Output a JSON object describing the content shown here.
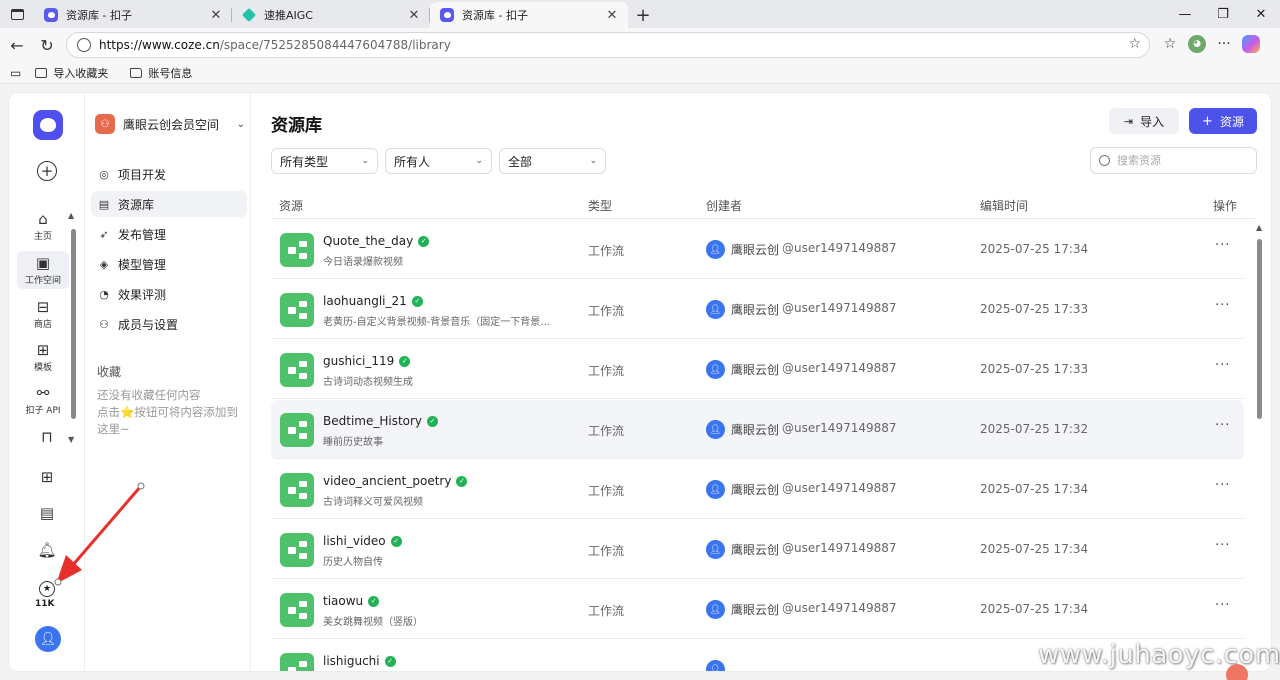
{
  "browser": {
    "tabs": [
      {
        "title": "资源库 - 扣子",
        "favicon": "coze",
        "state": "inactive"
      },
      {
        "title": "速推AIGC",
        "favicon": "aigc",
        "state": "inactive"
      },
      {
        "title": "资源库 - 扣子",
        "favicon": "coze",
        "state": "active"
      }
    ],
    "url_host": "https://www.coze.cn",
    "url_path": "/space/7525285084447604788/library",
    "bookmarks": [
      "导入收藏夹",
      "账号信息"
    ]
  },
  "rail": {
    "items": [
      {
        "label": "主页",
        "icon": "home-icon",
        "glyph": "⌂",
        "active": false
      },
      {
        "label": "工作空间",
        "icon": "terminal-icon",
        "glyph": "▣",
        "active": true
      },
      {
        "label": "商店",
        "icon": "store-icon",
        "glyph": "⊟",
        "active": false
      },
      {
        "label": "模板",
        "icon": "template-icon",
        "glyph": "⊞",
        "active": false
      },
      {
        "label": "扣子 API",
        "icon": "api-link-icon",
        "glyph": "⚯",
        "active": false
      }
    ],
    "credit_label": "11K"
  },
  "sidebar": {
    "space_name": "鹰眼云创会员空间",
    "menu": [
      {
        "label": "项目开发",
        "glyph": "◎",
        "active": false
      },
      {
        "label": "资源库",
        "glyph": "▤",
        "active": true
      },
      {
        "label": "发布管理",
        "glyph": "➶",
        "active": false
      },
      {
        "label": "模型管理",
        "glyph": "◈",
        "active": false
      },
      {
        "label": "效果评测",
        "glyph": "◔",
        "active": false
      },
      {
        "label": "成员与设置",
        "glyph": "⚇",
        "active": false
      }
    ],
    "favorites_title": "收藏",
    "favorites_empty": "还没有收藏任何内容\n点击⭐按钮可将内容添加到这里~"
  },
  "main": {
    "title": "资源库",
    "import_label": "导入",
    "add_label": "资源",
    "filters": [
      "所有类型",
      "所有人",
      "全部"
    ],
    "search_placeholder": "搜索资源",
    "columns": [
      "资源",
      "类型",
      "创建者",
      "编辑时间",
      "操作"
    ]
  },
  "rows": [
    {
      "name": "Quote_the_day",
      "desc": "今日语录爆款视频",
      "type": "工作流",
      "creator": "鹰眼云创",
      "uid": "@user1497149887",
      "time": "2025-07-25 17:34"
    },
    {
      "name": "laohuangli_21",
      "desc": "老黄历-自定义背景视频-背景音乐（固定一下背景…",
      "type": "工作流",
      "creator": "鹰眼云创",
      "uid": "@user1497149887",
      "time": "2025-07-25 17:33"
    },
    {
      "name": "gushici_119",
      "desc": "古诗词动态视频生成",
      "type": "工作流",
      "creator": "鹰眼云创",
      "uid": "@user1497149887",
      "time": "2025-07-25 17:33"
    },
    {
      "name": "Bedtime_History",
      "desc": "睡前历史故事",
      "type": "工作流",
      "creator": "鹰眼云创",
      "uid": "@user1497149887",
      "time": "2025-07-25 17:32"
    },
    {
      "name": "video_ancient_poetry",
      "desc": "古诗词释义可爱风视频",
      "type": "工作流",
      "creator": "鹰眼云创",
      "uid": "@user1497149887",
      "time": "2025-07-25 17:34"
    },
    {
      "name": "lishi_video",
      "desc": "历史人物自传",
      "type": "工作流",
      "creator": "鹰眼云创",
      "uid": "@user1497149887",
      "time": "2025-07-25 17:34"
    },
    {
      "name": "tiaowu",
      "desc": "美女跳舞视频（竖版）",
      "type": "工作流",
      "creator": "鹰眼云创",
      "uid": "@user1497149887",
      "time": "2025-07-25 17:34"
    },
    {
      "name": "lishiguchi",
      "desc": "",
      "type": "",
      "creator": "",
      "uid": "",
      "time": ""
    }
  ],
  "hover_row_index": 3,
  "watermark": "www.juhaoyc.com",
  "colors": {
    "accent": "#4d53e8",
    "workflow_green": "#4fc16a",
    "verified": "#20b355",
    "annotation_red": "#e8302a"
  }
}
